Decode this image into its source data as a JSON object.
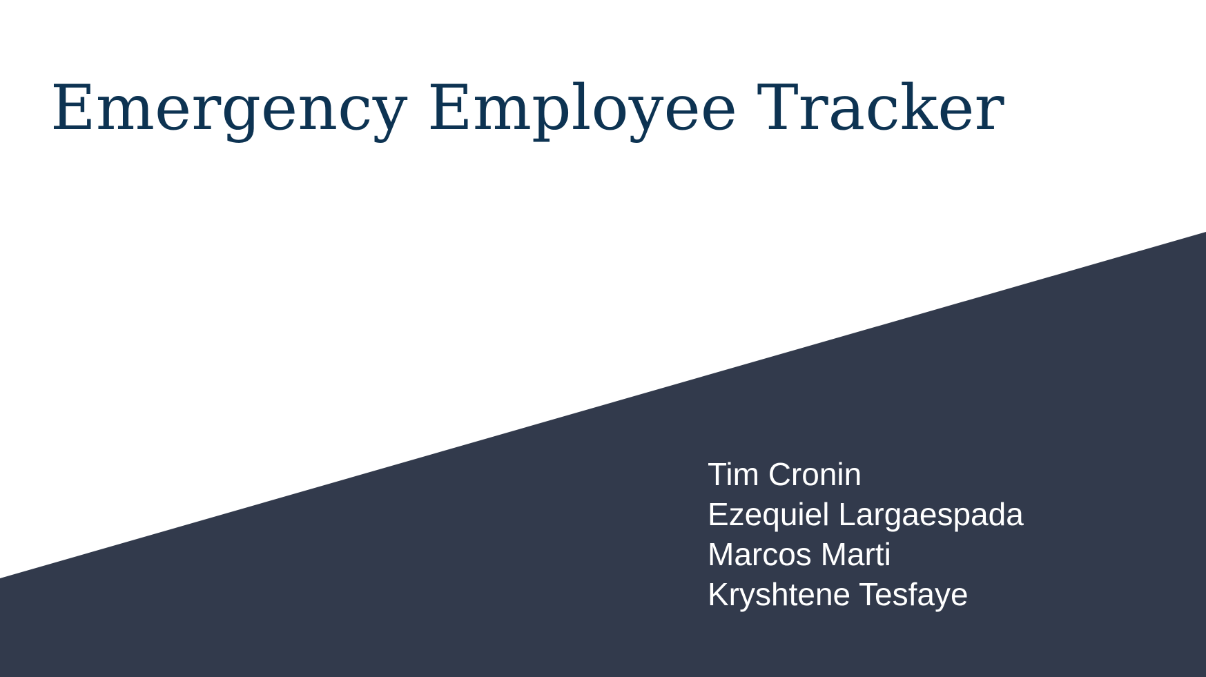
{
  "slide": {
    "title": "Emergency Employee Tracker",
    "authors": [
      "Tim Cronin",
      "Ezequiel Largaespada",
      "Marcos Marti",
      "Kryshtene Tesfaye"
    ]
  },
  "colors": {
    "background": "#ffffff",
    "title_text": "#0d3352",
    "diagonal_shape": "#323a4c",
    "author_text": "#ffffff"
  }
}
